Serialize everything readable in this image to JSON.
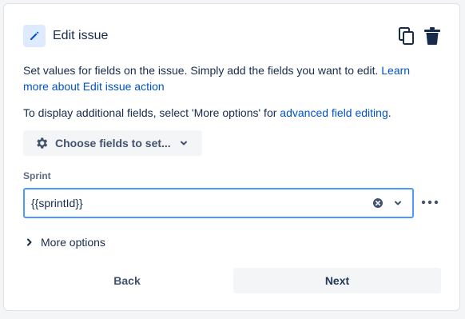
{
  "header": {
    "title": "Edit issue",
    "action_icon": "pencil-icon",
    "copy_icon": "copy-icon",
    "delete_icon": "trash-icon"
  },
  "description": {
    "line1_text": "Set values for fields on the issue. Simply add the fields you want to edit. ",
    "line1_link": "Learn more about Edit issue action",
    "line2_text": "To display additional fields, select 'More options' for ",
    "line2_link": "advanced field editing",
    "line2_end": "."
  },
  "choose_fields": {
    "label": "Choose fields to set...",
    "icon": "gear-icon"
  },
  "sprint_field": {
    "label": "Sprint",
    "value": "{{sprintId}}"
  },
  "more_options": {
    "label": "More options"
  },
  "footer": {
    "back_label": "Back",
    "next_label": "Next"
  },
  "colors": {
    "accent": "#0052cc",
    "focus_border": "#4c9aff",
    "icon_bg": "#deebff",
    "text": "#172b4d"
  }
}
